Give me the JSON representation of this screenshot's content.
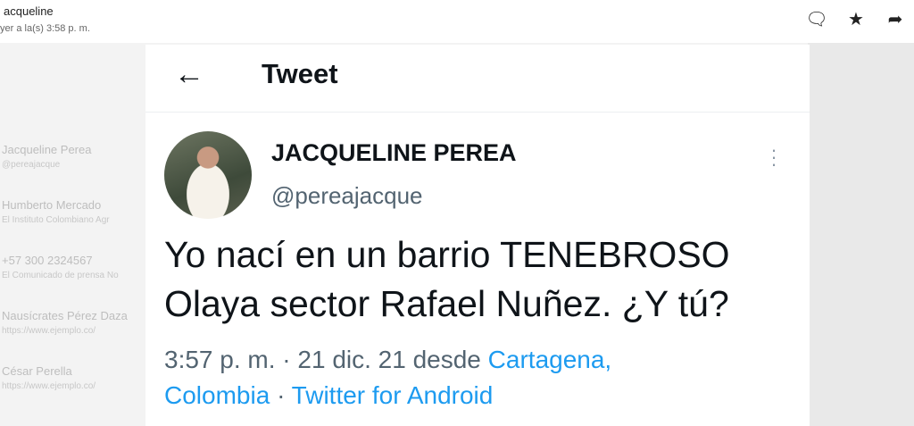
{
  "email": {
    "sender": "acqueline",
    "time": "yer a la(s) 3:58 p. m.",
    "actions": [
      {
        "name": "comment-icon",
        "glyph": "🗨"
      },
      {
        "name": "star-icon",
        "glyph": "★"
      },
      {
        "name": "forward-icon",
        "glyph": "➦"
      }
    ]
  },
  "background_list": [
    {
      "name": "Jacqueline Perea",
      "sub": "@pereajacque"
    },
    {
      "name": "Humberto Mercado",
      "sub": "El Instituto Colombiano Agr"
    },
    {
      "name": "+57 300 2324567",
      "sub": "El Comunicado de prensa No"
    },
    {
      "name": "Nausícrates Pérez Daza",
      "sub": "https://www.ejemplo.co/"
    },
    {
      "name": "César Perella",
      "sub": "https://www.ejemplo.co/"
    }
  ],
  "tweet": {
    "header_title": "Tweet",
    "author_name": "JACQUELINE PEREA",
    "author_handle": "@pereajacque",
    "text_line1": "Yo nací en un barrio TENEBROSO",
    "text_line2": "Olaya sector Rafael Nuñez. ¿Y tú?",
    "timestamp": "3:57 p. m. · 21 dic. 21 desde",
    "location_line1": "Cartagena,",
    "location_line2": "Colombia",
    "separator": "·",
    "source": "Twitter for Android"
  },
  "colors": {
    "accent": "#1d9bf0",
    "text": "#0f1419",
    "secondary": "#536471"
  }
}
